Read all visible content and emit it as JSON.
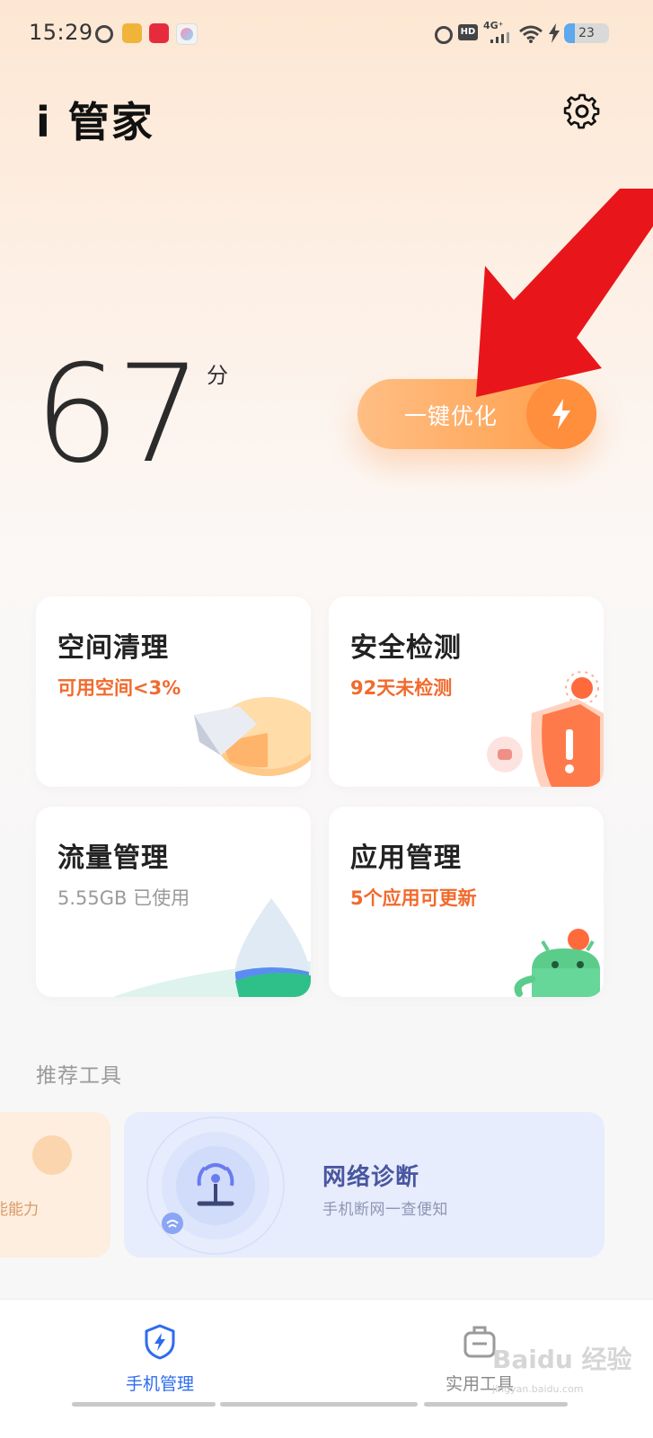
{
  "status_bar": {
    "time": "15:29",
    "network": "4G⁺",
    "hd": "HD",
    "battery": "23",
    "battery_level": 0.23,
    "icons": [
      "alarm-icon",
      "app-icon",
      "app-icon",
      "app-icon",
      "alarm-icon",
      "hd-icon",
      "signal-icon",
      "wifi-icon",
      "charging-icon",
      "battery-icon"
    ]
  },
  "header": {
    "title": "i 管家",
    "settings_icon": "gear-icon"
  },
  "score": {
    "value": "67",
    "unit": "分"
  },
  "optimize_button": {
    "label": "一键优化",
    "icon": "lightning-icon"
  },
  "colors": {
    "accent_orange": "#ff9c47",
    "warning_text": "#f26a2d",
    "nav_active": "#2d6cf0",
    "annotation_arrow": "#e8161b"
  },
  "cards": [
    {
      "title": "空间清理",
      "subtitle": "可用空间<3%",
      "icon": "pie-chart-icon"
    },
    {
      "title": "安全检测",
      "subtitle": "92天未检测",
      "icon": "shield-alert-icon"
    },
    {
      "title": "流量管理",
      "subtitle": "5.55GB 已使用",
      "icon": "water-drop-icon"
    },
    {
      "title": "应用管理",
      "subtitle": "5个应用可更新",
      "icon": "android-robot-icon"
    }
  ],
  "tools": {
    "heading": "推荐工具",
    "left_partial_label": "能能力",
    "network": {
      "title": "网络诊断",
      "subtitle": "手机断网一查便知",
      "icon": "network-antenna-icon"
    }
  },
  "bottom_nav": {
    "items": [
      {
        "label": "手机管理",
        "icon": "shield-bolt-icon",
        "active": true
      },
      {
        "label": "实用工具",
        "icon": "toolbox-icon",
        "active": false
      }
    ]
  },
  "watermark": {
    "text": "Baidu 经验",
    "url": "jingyan.baidu.com"
  }
}
